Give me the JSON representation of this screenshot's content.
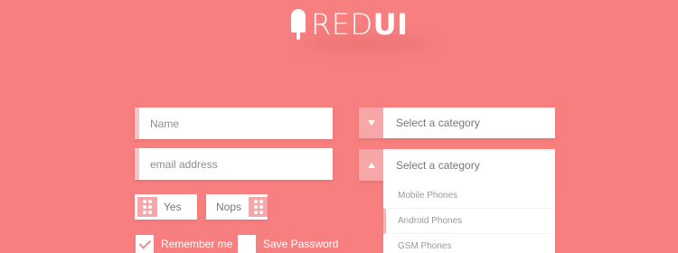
{
  "logo": {
    "text_light": "RED",
    "text_bold": "UI",
    "icon": "popsicle-icon"
  },
  "form": {
    "name_placeholder": "Name",
    "email_placeholder": "email address",
    "toggles": [
      {
        "label": "Yes",
        "icon": "grid-dots-icon"
      },
      {
        "label": "Nops",
        "icon": "grid-dots-icon"
      }
    ],
    "checkboxes": [
      {
        "label": "Remember me",
        "checked": true
      },
      {
        "label": "Save Password",
        "checked": false
      }
    ]
  },
  "selects": [
    {
      "value": "Select a category",
      "icon": "triangle-down-icon",
      "open": false
    },
    {
      "value": "Select a category",
      "icon": "triangle-up-icon",
      "open": true
    }
  ],
  "dropdown": {
    "items": [
      "Mobile Phones",
      "Android Phones",
      "GSM Phones"
    ],
    "highlighted": "Android Phones"
  },
  "colors": {
    "background": "#f87f7f",
    "accent_light": "#f7a7a7",
    "input_border": "#f6c7c7",
    "white": "#ffffff"
  }
}
